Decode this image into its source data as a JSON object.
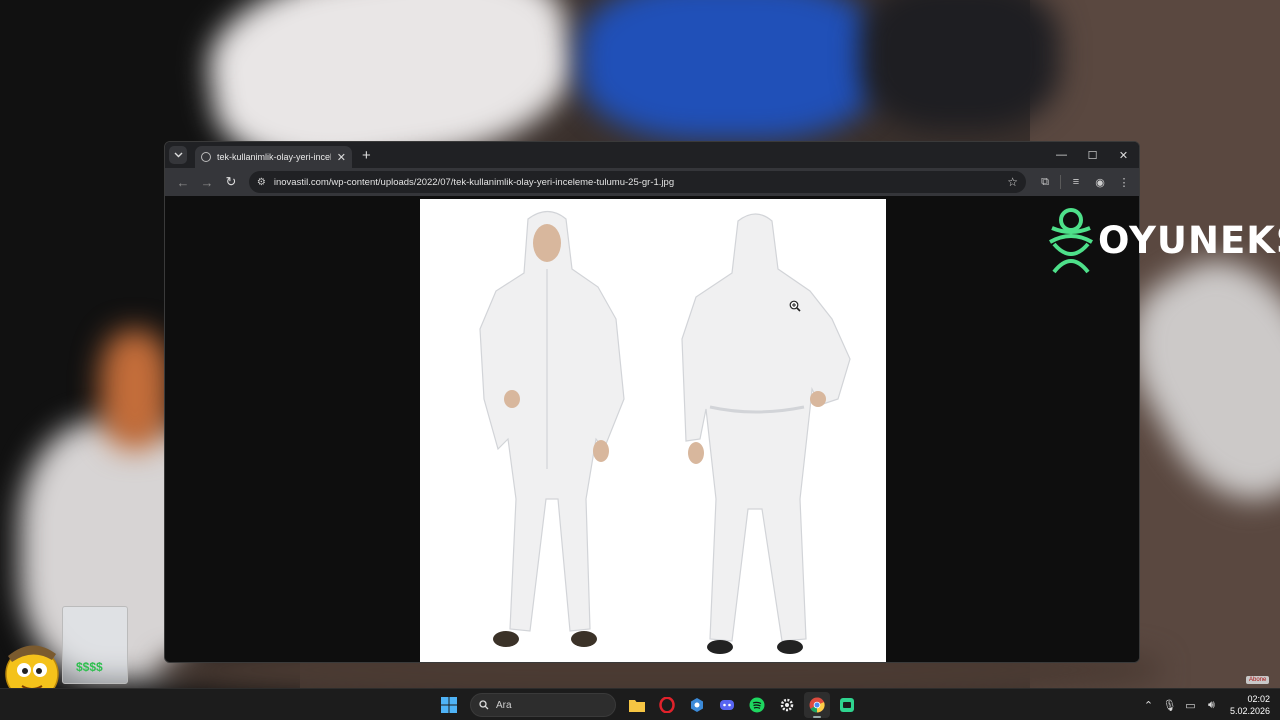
{
  "browser": {
    "tab_title": "tek-kullanimlik-olay-yeri-incele",
    "url": "inovastil.com/wp-content/uploads/2022/07/tek-kullanimlik-olay-yeri-inceleme-tulumu-25-gr-1.jpg"
  },
  "logo": {
    "text": "OYUNEKS",
    "color": "#4ee08a"
  },
  "badge": {
    "text": "Abone"
  },
  "taskbar": {
    "search_placeholder": "Ara",
    "apps": [
      "windows-start",
      "search",
      "file-explorer",
      "opera",
      "app-blue",
      "discord",
      "spotify",
      "settings",
      "chrome",
      "notes-app"
    ]
  },
  "clock": {
    "time": "02:02",
    "date": "5.02.2026"
  },
  "colors": {
    "accent": "#4ee08a",
    "titlebar": "#202124",
    "toolbar": "#35363a"
  }
}
